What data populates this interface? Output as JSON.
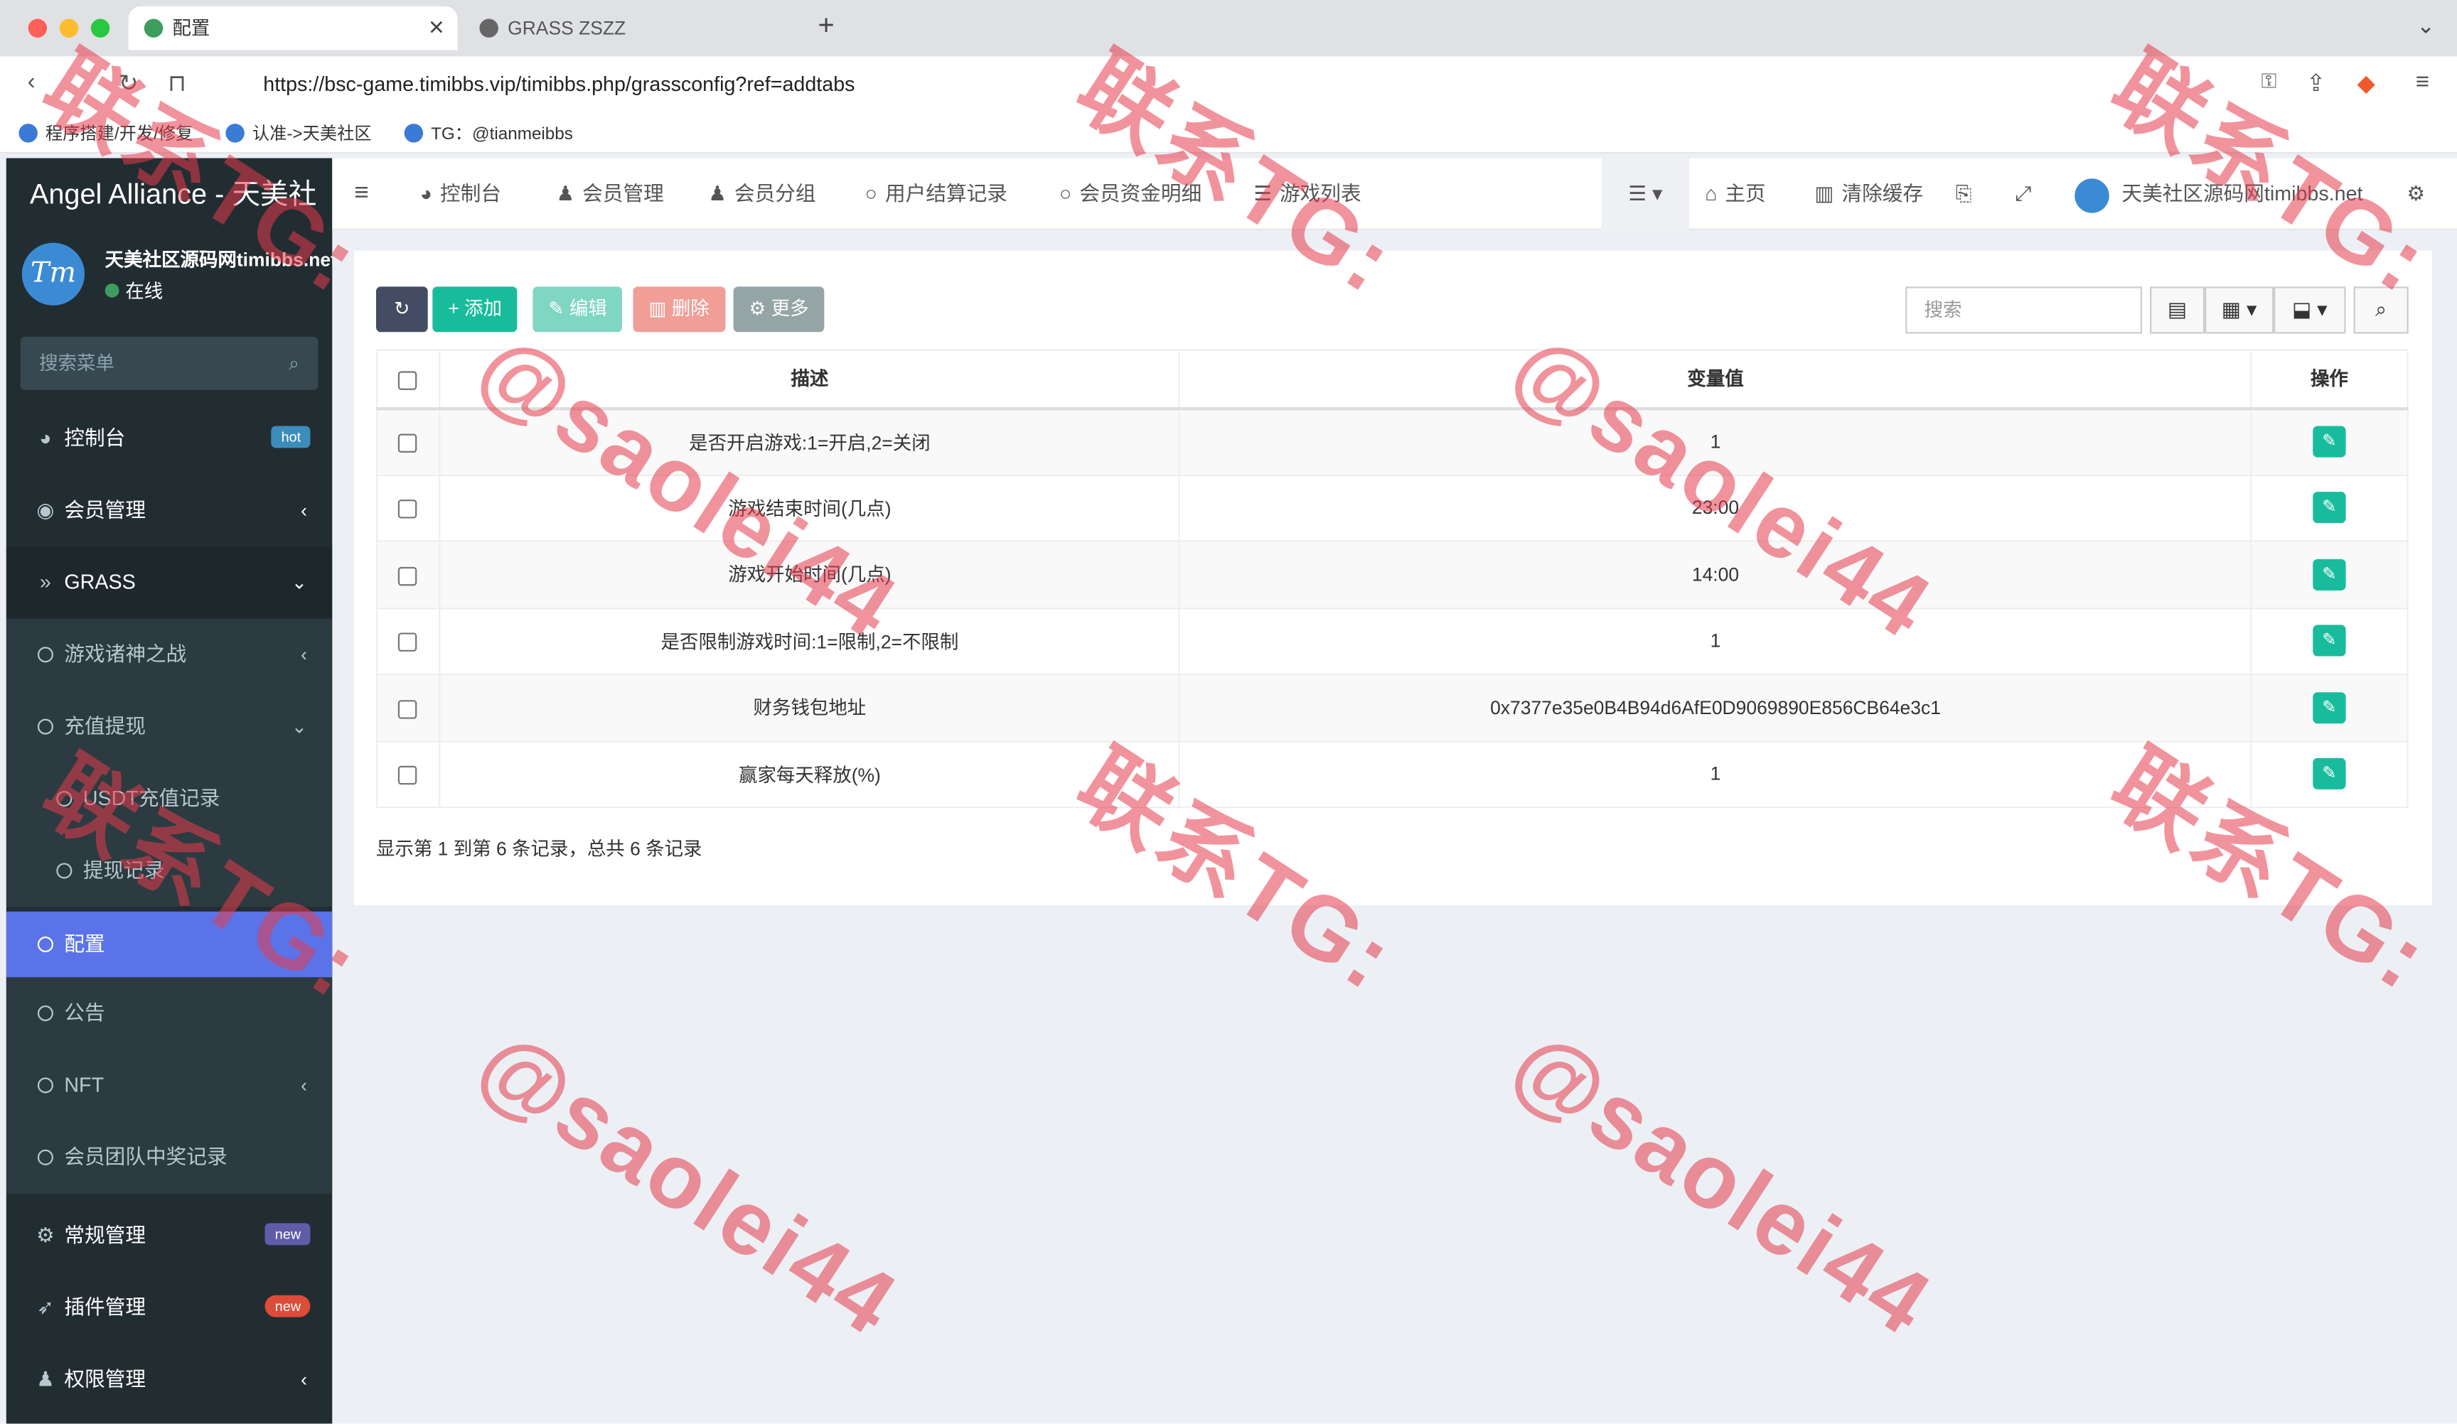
{
  "browser": {
    "tabs": [
      {
        "title": "配置",
        "active": true
      },
      {
        "title": "GRASS ZSZZ",
        "active": false
      }
    ],
    "url": "https://bsc-game.timibbs.vip/timibbs.php/grassconfig?ref=addtabs",
    "bookmarks": [
      "程序搭建/开发/修复",
      "认准->天美社区",
      "TG：@tianmeibbs"
    ]
  },
  "sidebar": {
    "logo": "Angel Alliance - 天美社",
    "user_name": "天美社区源码网timibbs.net",
    "user_status": "在线",
    "search_placeholder": "搜索菜单",
    "items": [
      {
        "label": "控制台",
        "icon": "dashboard-icon",
        "badge": "hot",
        "badge_color": "#3c8dbc"
      },
      {
        "label": "会员管理",
        "icon": "user-circle-icon",
        "arrow": "‹"
      },
      {
        "label": "GRASS",
        "icon": "double-chevron-icon",
        "arrow": "⌄"
      },
      {
        "label": "游戏诸神之战",
        "arrow": "‹"
      },
      {
        "label": "充值提现",
        "arrow": "⌄"
      },
      {
        "label": "USDT充值记录"
      },
      {
        "label": "提现记录"
      },
      {
        "label": "配置"
      },
      {
        "label": "公告"
      },
      {
        "label": "NFT",
        "arrow": "‹"
      },
      {
        "label": "会员团队中奖记录"
      },
      {
        "label": "常规管理",
        "icon": "cogs-icon",
        "badge": "new",
        "badge_color": "#605ca8"
      },
      {
        "label": "插件管理",
        "icon": "rocket-icon",
        "badge": "new",
        "badge_color": "#dd4b39"
      },
      {
        "label": "权限管理",
        "icon": "group-icon",
        "arrow": "‹"
      }
    ]
  },
  "header": {
    "menu_toggle": "≡",
    "nav": [
      "控制台",
      "会员管理",
      "会员分组",
      "用户结算记录",
      "会员资金明细",
      "游戏列表"
    ],
    "home": "主页",
    "clear_cache": "清除缓存",
    "site_name": "天美社区源码网timibbs.net"
  },
  "toolbar": {
    "add": "添加",
    "edit": "编辑",
    "delete": "删除",
    "more": "更多",
    "search_placeholder": "搜索"
  },
  "table": {
    "columns": [
      "描述",
      "变量值",
      "操作"
    ],
    "rows": [
      {
        "desc": "是否开启游戏:1=开启,2=关闭",
        "value": "1"
      },
      {
        "desc": "游戏结束时间(几点)",
        "value": "23:00"
      },
      {
        "desc": "游戏开始时间(几点)",
        "value": "14:00"
      },
      {
        "desc": "是否限制游戏时间:1=限制,2=不限制",
        "value": "1"
      },
      {
        "desc": "财务钱包地址",
        "value": "0x7377e35e0B4B94d6AfE0D9069890E856CB64e3c1"
      },
      {
        "desc": "赢家每天释放(%)",
        "value": "1"
      }
    ]
  },
  "pagination_info": "显示第 1 到第 6 条记录，总共 6 条记录",
  "watermark": {
    "line1": "联系TG:",
    "line2": "@saolei44",
    "color": "#e63b4c"
  }
}
